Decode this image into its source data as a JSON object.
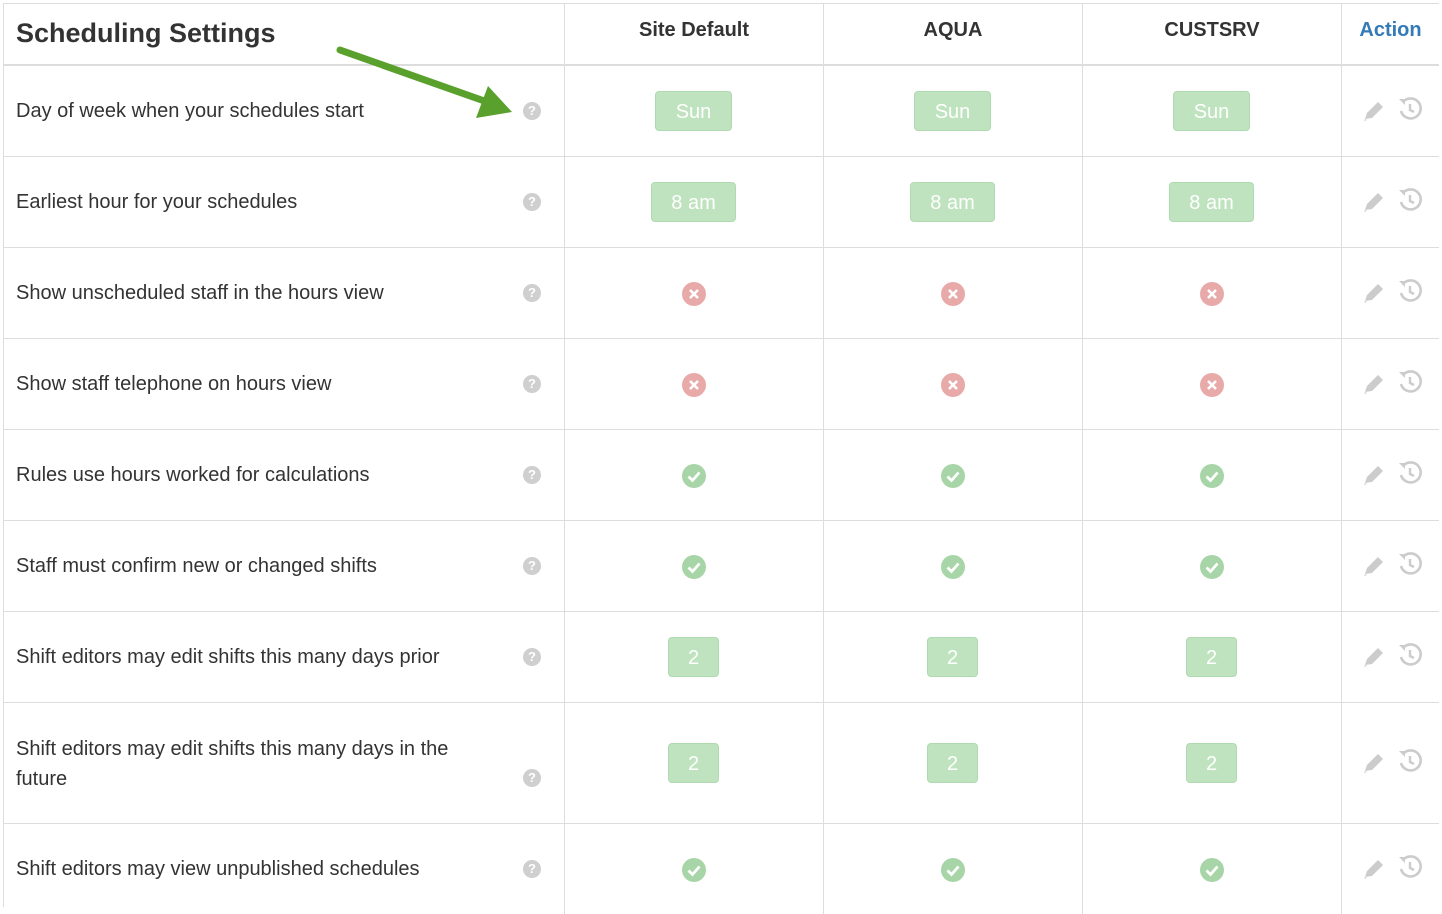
{
  "header": {
    "title": "Scheduling Settings",
    "columns": [
      "Site Default",
      "AQUA",
      "CUSTSRV"
    ],
    "action_label": "Action"
  },
  "colors": {
    "accent": "#337ab7",
    "pill_bg": "#bfe3bf",
    "yes": "#a8d5a8",
    "no": "#e8a9a9",
    "annotation_arrow": "#5aa02c"
  },
  "rows": [
    {
      "label": "Day of week when your schedules start",
      "type": "pill",
      "values": [
        "Sun",
        "Sun",
        "Sun"
      ]
    },
    {
      "label": "Earliest hour for your schedules",
      "type": "pill",
      "values": [
        "8 am",
        "8 am",
        "8 am"
      ]
    },
    {
      "label": "Show unscheduled staff in the hours view",
      "type": "bool",
      "values": [
        false,
        false,
        false
      ]
    },
    {
      "label": "Show staff telephone on hours view",
      "type": "bool",
      "values": [
        false,
        false,
        false
      ]
    },
    {
      "label": "Rules use hours worked for calculations",
      "type": "bool",
      "values": [
        true,
        true,
        true
      ]
    },
    {
      "label": "Staff must confirm new or changed shifts",
      "type": "bool",
      "values": [
        true,
        true,
        true
      ]
    },
    {
      "label": "Shift editors may edit shifts this many days prior",
      "type": "pill",
      "values": [
        "2",
        "2",
        "2"
      ]
    },
    {
      "label_line1": "Shift editors may edit shifts this many days in the",
      "label_line2": "future",
      "type": "pill",
      "values": [
        "2",
        "2",
        "2"
      ]
    },
    {
      "label": "Shift editors may view unpublished schedules",
      "type": "bool",
      "values": [
        true,
        true,
        true
      ]
    }
  ],
  "icons": {
    "help": "question-circle-icon",
    "yes": "check-circle-icon",
    "no": "times-circle-icon",
    "edit": "pencil-icon",
    "reset": "history-icon"
  }
}
